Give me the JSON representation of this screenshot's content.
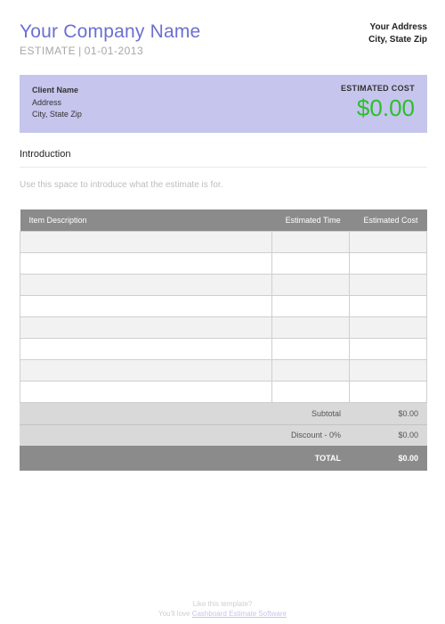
{
  "header": {
    "company_name": "Your Company Name",
    "estimate_label": "ESTIMATE",
    "estimate_date": "01-01-2013",
    "your_address_line1": "Your Address",
    "your_address_line2": "City, State Zip"
  },
  "client_box": {
    "client_name": "Client Name",
    "address1": "Address",
    "address2": "City, State Zip",
    "estimated_cost_label": "ESTIMATED COST",
    "estimated_cost_value": "$0.00"
  },
  "introduction": {
    "heading": "Introduction",
    "body": "Use this space to introduce what the estimate is for."
  },
  "items": {
    "columns": {
      "desc": "Item Description",
      "time": "Estimated Time",
      "cost": "Estimated Cost"
    },
    "rows": [
      {
        "desc": "",
        "time": "",
        "cost": ""
      },
      {
        "desc": "",
        "time": "",
        "cost": ""
      },
      {
        "desc": "",
        "time": "",
        "cost": ""
      },
      {
        "desc": "",
        "time": "",
        "cost": ""
      },
      {
        "desc": "",
        "time": "",
        "cost": ""
      },
      {
        "desc": "",
        "time": "",
        "cost": ""
      },
      {
        "desc": "",
        "time": "",
        "cost": ""
      },
      {
        "desc": "",
        "time": "",
        "cost": ""
      }
    ]
  },
  "summary": {
    "subtotal_label": "Subtotal",
    "subtotal_value": "$0.00",
    "discount_label": "Discount - 0%",
    "discount_value": "$0.00",
    "total_label": "TOTAL",
    "total_value": "$0.00"
  },
  "footer": {
    "line1": "Like this template?",
    "line2_prefix": "You'll love ",
    "link_text": "Cashboard Estimate Software"
  }
}
